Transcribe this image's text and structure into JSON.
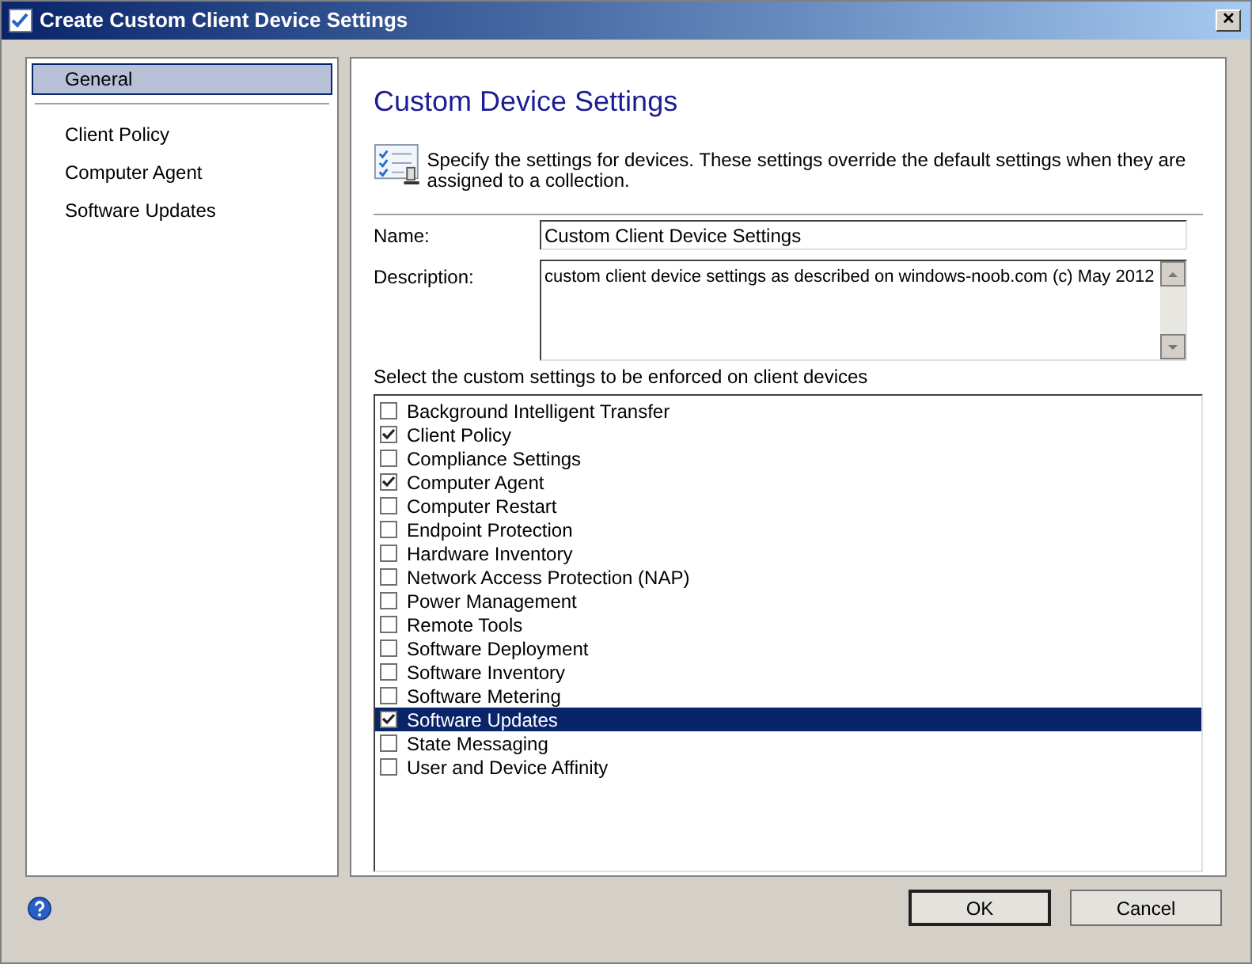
{
  "window": {
    "title": "Create Custom Client Device Settings",
    "close": "✕"
  },
  "sidebar": {
    "items": [
      {
        "label": "General",
        "selected": true
      },
      {
        "label": "Client Policy",
        "selected": false
      },
      {
        "label": "Computer Agent",
        "selected": false
      },
      {
        "label": "Software Updates",
        "selected": false
      }
    ]
  },
  "page": {
    "title": "Custom Device Settings",
    "intro": "Specify the settings for devices. These settings override the default settings when they are assigned to a collection.",
    "name_label": "Name:",
    "name_value": "Custom Client Device Settings",
    "description_label": "Description:",
    "description_value": "custom client device settings as described on windows-noob.com (c) May 2012",
    "settings_label": "Select the custom settings to be enforced on client devices",
    "settings": [
      {
        "label": "Background Intelligent Transfer",
        "checked": false,
        "selected": false
      },
      {
        "label": "Client Policy",
        "checked": true,
        "selected": false
      },
      {
        "label": "Compliance Settings",
        "checked": false,
        "selected": false
      },
      {
        "label": "Computer Agent",
        "checked": true,
        "selected": false
      },
      {
        "label": "Computer Restart",
        "checked": false,
        "selected": false
      },
      {
        "label": "Endpoint Protection",
        "checked": false,
        "selected": false
      },
      {
        "label": "Hardware Inventory",
        "checked": false,
        "selected": false
      },
      {
        "label": "Network Access Protection (NAP)",
        "checked": false,
        "selected": false
      },
      {
        "label": "Power Management",
        "checked": false,
        "selected": false
      },
      {
        "label": "Remote Tools",
        "checked": false,
        "selected": false
      },
      {
        "label": "Software Deployment",
        "checked": false,
        "selected": false
      },
      {
        "label": "Software Inventory",
        "checked": false,
        "selected": false
      },
      {
        "label": "Software Metering",
        "checked": false,
        "selected": false
      },
      {
        "label": "Software Updates",
        "checked": true,
        "selected": true
      },
      {
        "label": "State Messaging",
        "checked": false,
        "selected": false
      },
      {
        "label": "User and Device Affinity",
        "checked": false,
        "selected": false
      }
    ]
  },
  "buttons": [
    {
      "label": "OK",
      "default": true
    },
    {
      "label": "Cancel",
      "default": false
    }
  ]
}
